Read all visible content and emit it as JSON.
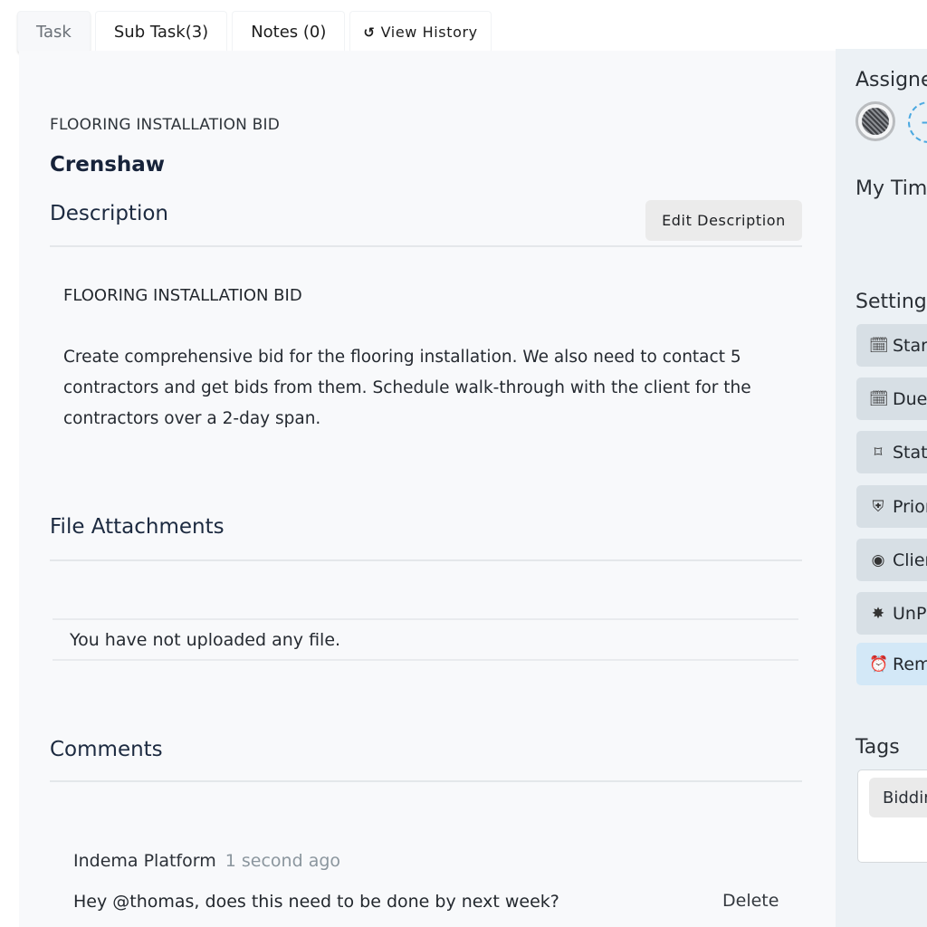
{
  "tabs": [
    {
      "label": "Task",
      "active": true
    },
    {
      "label": "Sub Task(3)"
    },
    {
      "label": "Notes (0)"
    },
    {
      "label": "View History",
      "icon": "history-icon"
    }
  ],
  "task": {
    "category": "FLOORING INSTALLATION BID",
    "title": "Crenshaw"
  },
  "description": {
    "heading": "Description",
    "edit_label": "Edit Description",
    "body_title": "FLOORING INSTALLATION BID",
    "body_text": "Create comprehensive bid for the flooring installation. We also need to contact 5 contractors and get bids from them. Schedule walk-through with the client for the contractors over a 2-day span."
  },
  "attachments": {
    "heading": "File Attachments",
    "empty_text": "You have not uploaded any file."
  },
  "comments": {
    "heading": "Comments",
    "items": [
      {
        "author": "Indema Platform",
        "time": "1 second ago",
        "text": "Hey @thomas, does this need to be done by next week?",
        "delete_label": "Delete"
      }
    ]
  },
  "sidebar": {
    "assignees_heading": "Assignees",
    "add_assignee_icon": "+",
    "my_time_heading": "My Time",
    "settings_heading": "Settings",
    "settings": [
      {
        "label": "Start Date",
        "icon": "calendar-icon",
        "glyph": "🗓"
      },
      {
        "label": "Due Date",
        "icon": "calendar-icon",
        "glyph": "🗓"
      },
      {
        "label": "Status",
        "icon": "flag-icon",
        "glyph": "⌑"
      },
      {
        "label": "Priority",
        "icon": "shield-icon",
        "glyph": "⛨"
      },
      {
        "label": "Client",
        "icon": "eye-icon",
        "glyph": "◉"
      },
      {
        "label": "UnPin",
        "icon": "pin-icon",
        "glyph": "✸"
      },
      {
        "label": "Reminder",
        "icon": "alarm-clock-icon",
        "glyph": "⏰"
      }
    ],
    "tags_heading": "Tags",
    "tags": [
      "Bidding"
    ]
  },
  "colors": {
    "main_bg": "#f8f9fb",
    "sidebar_bg": "#ecf1f5",
    "setting_btn_bg": "#d7dfe5",
    "reminder_btn_bg": "#d3e8f7",
    "accent_dashed": "#4aa8e0",
    "muted_time": "#8b969e"
  }
}
